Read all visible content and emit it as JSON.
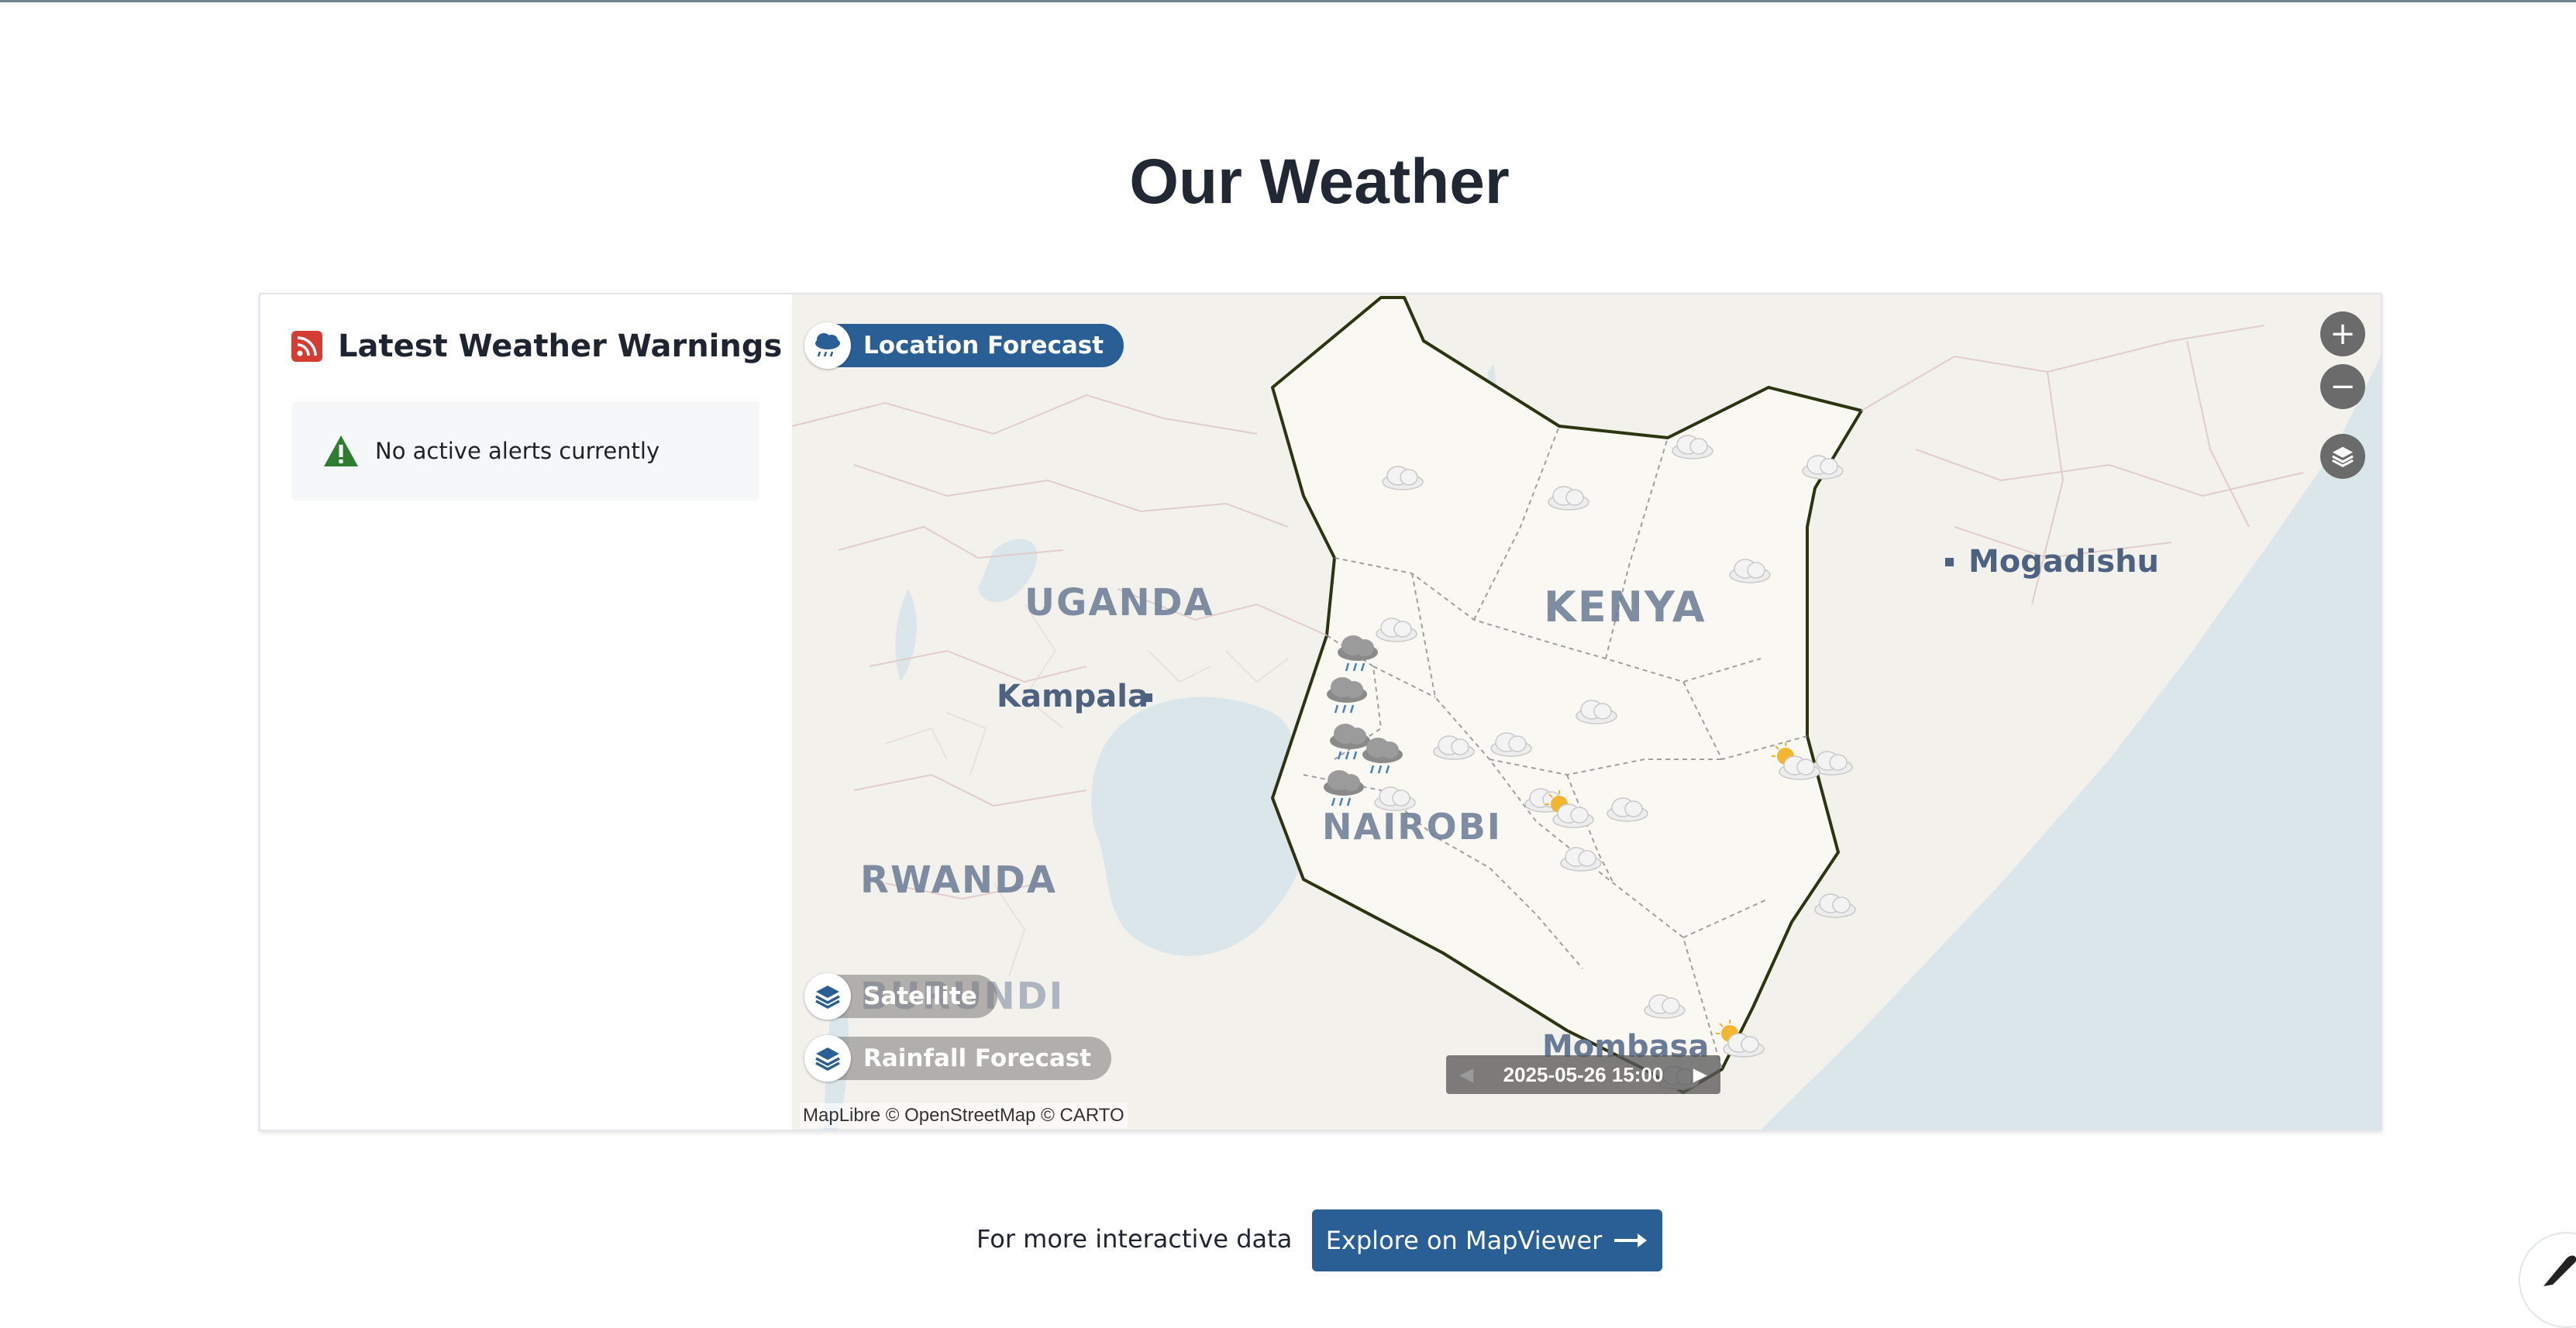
{
  "page": {
    "title": "Our Weather"
  },
  "warnings": {
    "title": "Latest Weather Warnings",
    "no_alerts": "No active alerts currently"
  },
  "map": {
    "location_forecast_label": "Location Forecast",
    "satellite_label": "Satellite",
    "rainfall_forecast_label": "Rainfall Forecast",
    "zoom_in": "+",
    "zoom_out": "−",
    "timestamp": "2025-05-26 15:00",
    "attribution": "MapLibre © OpenStreetMap © CARTO",
    "labels": {
      "uganda": "UGANDA",
      "kenya": "KENYA",
      "rwanda": "RWANDA",
      "burundi": "BURUNDI",
      "nairobi": "NAIROBI",
      "kampala": "Kampala",
      "mogadishu": "Mogadishu",
      "mombasa": "Mombasa"
    },
    "colors": {
      "water": "#dbe6ea",
      "land": "#f6f4ef",
      "kenya_fill": "#faf8f3",
      "border": "#2b3510"
    }
  },
  "footer": {
    "text": "For more interactive data",
    "button_label": "Explore on MapViewer"
  },
  "colors": {
    "primary": "#2a5f95",
    "rss": "#d43d33",
    "alert_icon": "#2e7d32"
  }
}
